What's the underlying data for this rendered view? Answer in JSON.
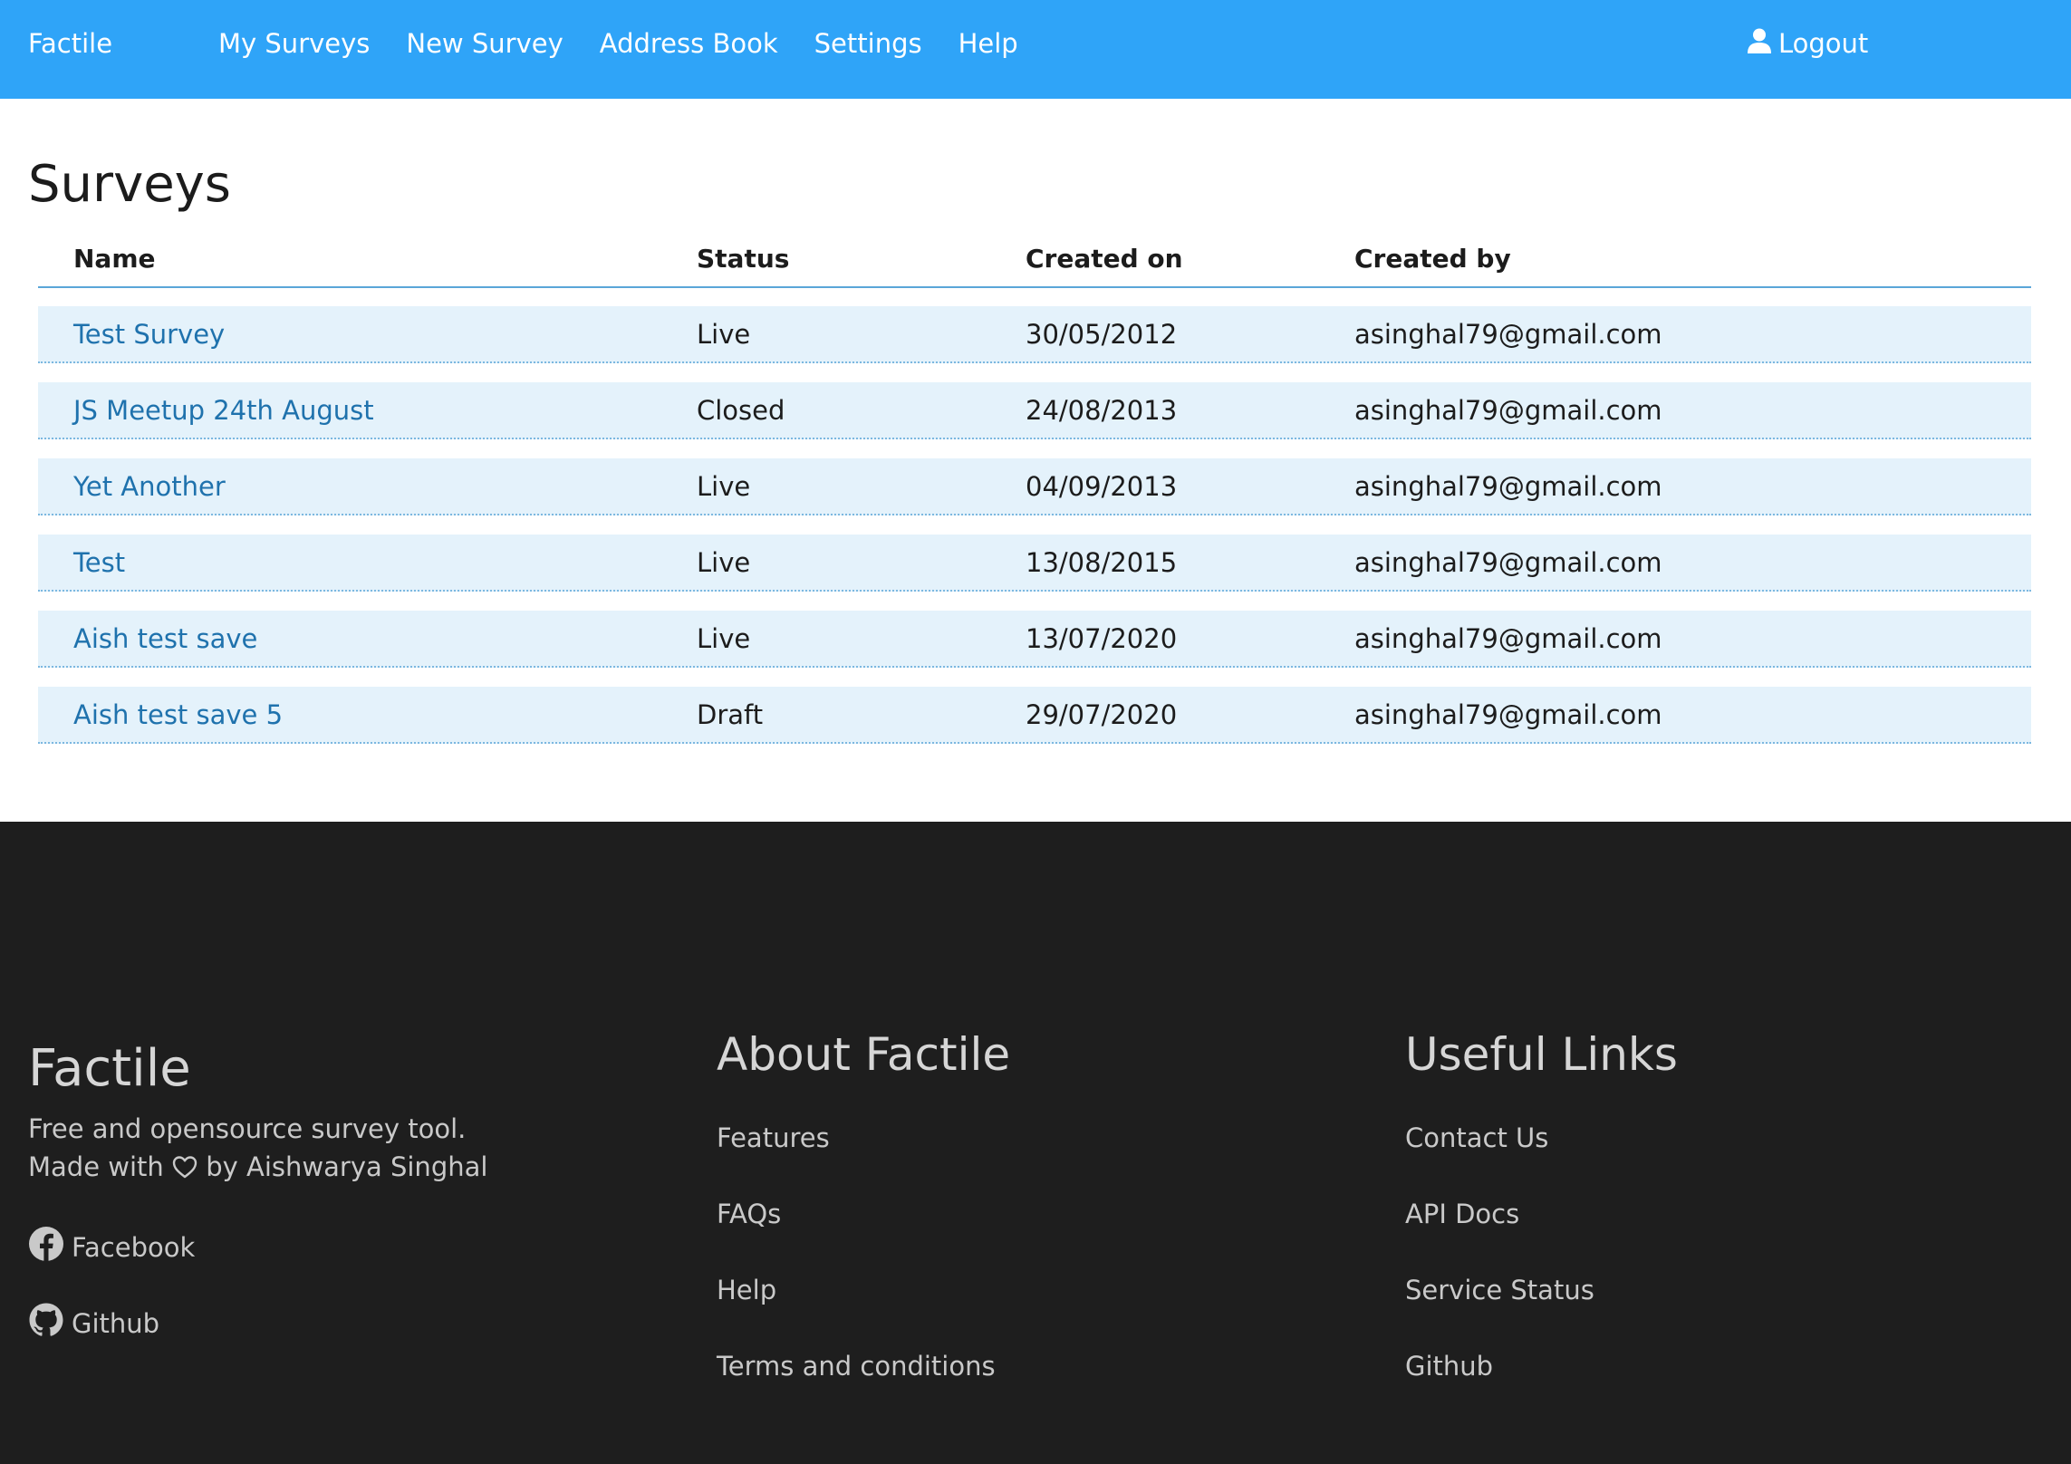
{
  "navbar": {
    "brand": "Factile",
    "links": [
      "My Surveys",
      "New Survey",
      "Address Book",
      "Settings",
      "Help"
    ],
    "logout_label": "Logout",
    "background_color": "#2fa4f8"
  },
  "main": {
    "title": "Surveys",
    "table": {
      "headers": [
        "Name",
        "Status",
        "Created on",
        "Created by"
      ],
      "rows": [
        {
          "name": "Test Survey",
          "status": "Live",
          "created_on": "30/05/2012",
          "created_by": "asinghal79@gmail.com"
        },
        {
          "name": "JS Meetup 24th August",
          "status": "Closed",
          "created_on": "24/08/2013",
          "created_by": "asinghal79@gmail.com"
        },
        {
          "name": "Yet Another",
          "status": "Live",
          "created_on": "04/09/2013",
          "created_by": "asinghal79@gmail.com"
        },
        {
          "name": "Test",
          "status": "Live",
          "created_on": "13/08/2015",
          "created_by": "asinghal79@gmail.com"
        },
        {
          "name": "Aish test save",
          "status": "Live",
          "created_on": "13/07/2020",
          "created_by": "asinghal79@gmail.com"
        },
        {
          "name": "Aish test save 5",
          "status": "Draft",
          "created_on": "29/07/2020",
          "created_by": "asinghal79@gmail.com"
        }
      ],
      "link_color": "#1f72ad",
      "row_background": "#e4f2fb"
    }
  },
  "footer": {
    "brand": "Factile",
    "tagline_line1": "Free and opensource survey tool.",
    "tagline_made_with": "Made with",
    "tagline_by": "by Aishwarya Singhal",
    "social": [
      {
        "label": "Facebook",
        "icon": "facebook-icon"
      },
      {
        "label": "Github",
        "icon": "github-icon"
      }
    ],
    "about": {
      "title": "About Factile",
      "links": [
        "Features",
        "FAQs",
        "Help",
        "Terms and conditions"
      ]
    },
    "useful": {
      "title": "Useful Links",
      "links": [
        "Contact Us",
        "API Docs",
        "Service Status",
        "Github"
      ]
    },
    "background_color": "#1e1e1e"
  }
}
